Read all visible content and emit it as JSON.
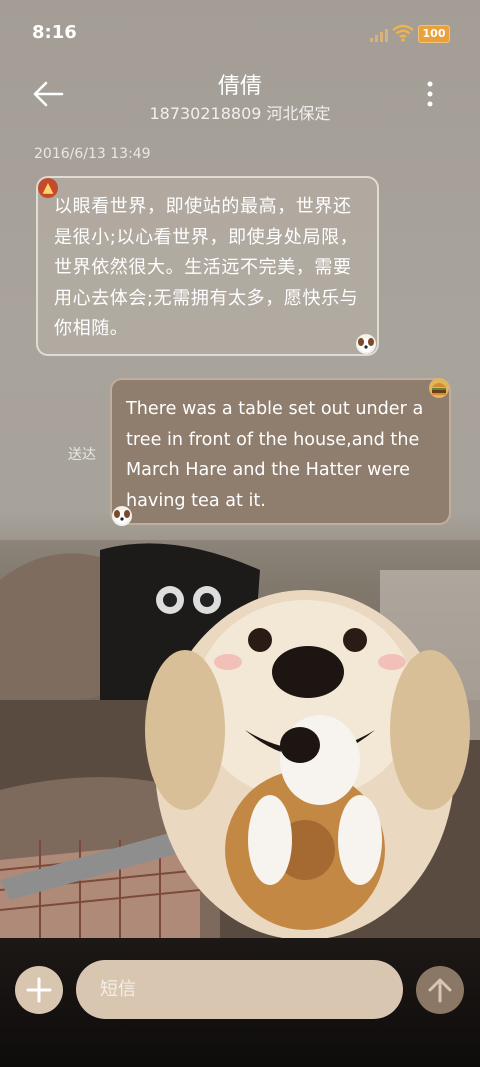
{
  "status_bar": {
    "time": "8:16",
    "battery": "100"
  },
  "header": {
    "contact_name": "倩倩",
    "contact_info": "18730218809 河北保定"
  },
  "messages": {
    "timestamp": "2016/6/13 13:49",
    "incoming_text": "以眼看世界，即使站的最高，世界还是很小;以心看世界，即使身处局限，世界依然很大。生活远不完美，需要用心去体会;无需拥有太多，愿快乐与你相随。",
    "outgoing_text": "There was a table set out under a tree in front of the house,and the March Hare and the Hatter were having tea at it.",
    "outgoing_status": "送达"
  },
  "composer": {
    "placeholder": "短信"
  },
  "colors": {
    "accent": "#d9c6b1",
    "send_button": "#8a7766",
    "outgoing_bubble": "#8f7d6d"
  }
}
